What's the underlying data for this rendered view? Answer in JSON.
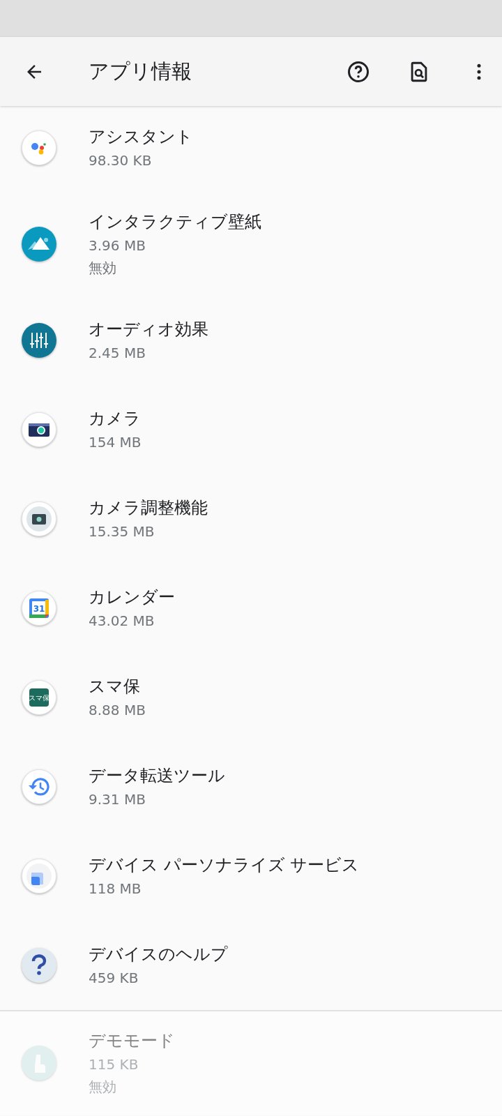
{
  "app_bar": {
    "title": "アプリ情報"
  },
  "apps": [
    {
      "name": "アシスタント",
      "size": "98.30 KB",
      "kind": "assistant",
      "dimmed": false
    },
    {
      "name": "インタラクティブ壁紙",
      "size": "3.96 MB",
      "status": "無効",
      "kind": "mountain",
      "dimmed": false
    },
    {
      "name": "オーディオ効果",
      "size": "2.45 MB",
      "kind": "equalizer",
      "dimmed": false
    },
    {
      "name": "カメラ",
      "size": "154 MB",
      "kind": "camera",
      "dimmed": false
    },
    {
      "name": "カメラ調整機能",
      "size": "15.35 MB",
      "kind": "cameragear",
      "dimmed": false
    },
    {
      "name": "カレンダー",
      "size": "43.02 MB",
      "kind": "calendar",
      "icon_text": "31",
      "dimmed": false
    },
    {
      "name": "スマ保",
      "size": "8.88 MB",
      "kind": "label",
      "icon_text": "スマ保",
      "dimmed": false
    },
    {
      "name": "データ転送ツール",
      "size": "9.31 MB",
      "kind": "history",
      "dimmed": false
    },
    {
      "name": "デバイス パーソナライズ サービス",
      "size": "118 MB",
      "kind": "layers",
      "dimmed": false
    },
    {
      "name": "デバイスのヘルプ",
      "size": "459 KB",
      "kind": "question",
      "dimmed": false
    },
    {
      "name": "デモモード",
      "size": "115 KB",
      "status": "無効",
      "kind": "hand",
      "dimmed": true
    }
  ]
}
